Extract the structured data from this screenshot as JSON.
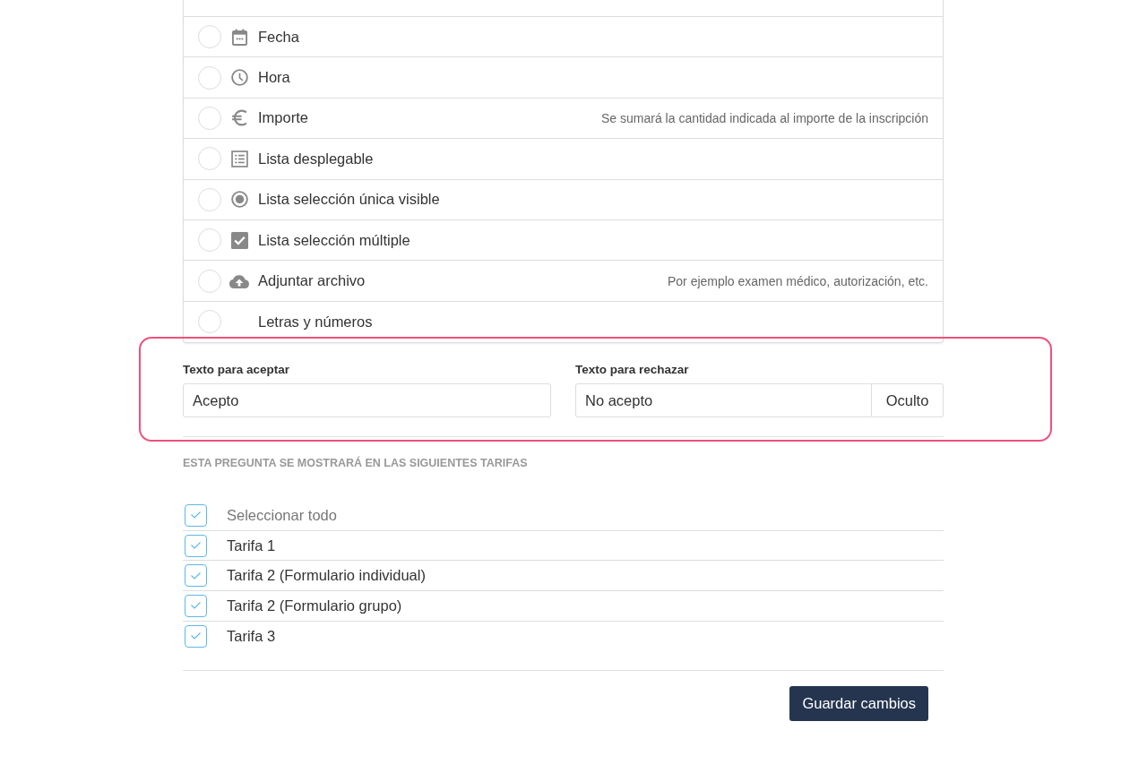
{
  "field_types": [
    {
      "kind": "date",
      "label": "Fecha",
      "selected": false
    },
    {
      "kind": "time",
      "label": "Hora",
      "selected": false
    },
    {
      "kind": "amount",
      "label": "Importe",
      "selected": false,
      "hint": "Se sumará la cantidad indicada al importe de la inscripción"
    },
    {
      "kind": "dropdown",
      "label": "Lista desplegable",
      "selected": false
    },
    {
      "kind": "single",
      "label": "Lista selección única visible",
      "selected": false
    },
    {
      "kind": "multiple",
      "label": "Lista selección múltiple",
      "selected": false
    },
    {
      "kind": "file",
      "label": "Adjuntar archivo",
      "selected": false,
      "hint": "Por ejemplo examen médico, autorización, etc."
    },
    {
      "kind": "text",
      "label": "Letras y números",
      "selected": false
    }
  ],
  "answer_texts": {
    "highlighted": true,
    "accept": {
      "label": "Texto para aceptar",
      "value": "Acepto"
    },
    "reject": {
      "label": "Texto para rechazar",
      "value": "No acepto",
      "toggle": "Oculto"
    }
  },
  "tariffs": {
    "heading": "ESTA PREGUNTA SE MOSTRARÁ EN LAS SIGUIENTES TARIFAS",
    "items": [
      {
        "kind": "all",
        "label": "Seleccionar todo",
        "checked": true
      },
      {
        "kind": "tariff",
        "label": "Tarifa 1",
        "checked": true
      },
      {
        "kind": "tariff",
        "label": "Tarifa 2 (Formulario individual)",
        "checked": true
      },
      {
        "kind": "tariff",
        "label": "Tarifa 2 (Formulario grupo)",
        "checked": true
      },
      {
        "kind": "tariff",
        "label": "Tarifa 3",
        "checked": true
      }
    ]
  },
  "save_button": "Guardar cambios"
}
